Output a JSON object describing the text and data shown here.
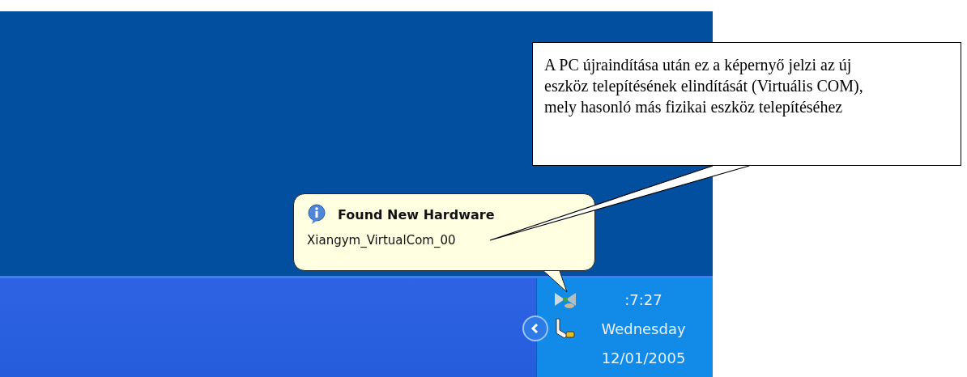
{
  "desktop": {
    "balloon": {
      "title": "Found New Hardware",
      "message": "Xiangym_VirtualCom_00"
    }
  },
  "taskbar": {
    "clock": {
      "time": ":7:27",
      "day": "Wednesday",
      "date": "12/01/2005"
    }
  },
  "annotation": {
    "text": "A PC újraindítása után ez a képernyő jelzi az új eszköz telepítésének elindítását (Virtuális COM), mely hasonló más fizikai eszköz telepítéséhez"
  }
}
